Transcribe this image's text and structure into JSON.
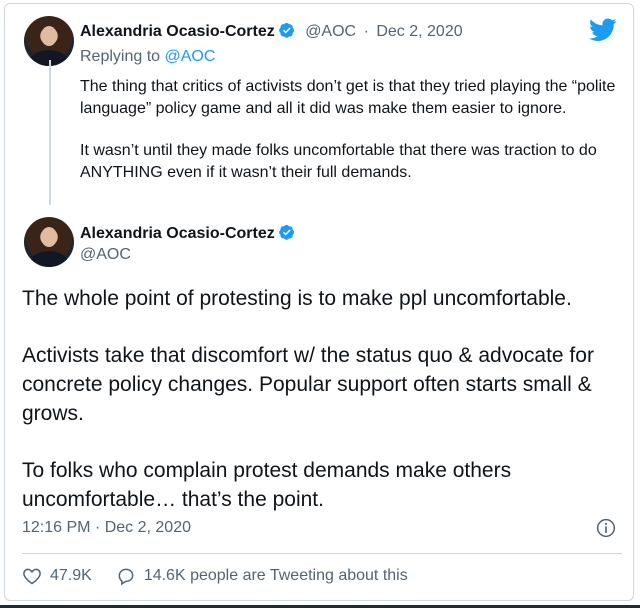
{
  "reply_tweet": {
    "author_name": "Alexandria Ocasio-Cortez",
    "handle": "@AOC",
    "separator": "·",
    "date": "Dec 2, 2020",
    "replying_prefix": "Replying to ",
    "replying_handle": "@AOC",
    "paragraphs": [
      "The thing that critics of activists don’t get is that they tried playing the “polite language” policy game and all it did was make them easier to ignore.",
      "It wasn’t until they made folks uncomfortable that there was traction to do ANYTHING even if it wasn’t their full demands."
    ]
  },
  "main_tweet": {
    "author_name": "Alexandria Ocasio-Cortez",
    "handle": "@AOC",
    "paragraphs": [
      "The whole point of protesting is to make ppl uncomfortable.",
      "Activists take that discomfort w/ the status quo & advocate for concrete policy changes. Popular support often starts small & grows.",
      "To folks who complain protest demands make others uncomfortable… that’s the point."
    ],
    "timestamp": "12:16 PM · Dec 2, 2020",
    "likes": "47.9K",
    "tweeting_about": "14.6K people are Tweeting about this"
  },
  "colors": {
    "accent": "#1d9bf0",
    "muted": "#536471",
    "border": "#cfd9de"
  },
  "icons": [
    "twitter-bird-icon",
    "verified-badge-icon",
    "info-icon",
    "heart-icon",
    "comment-icon"
  ]
}
